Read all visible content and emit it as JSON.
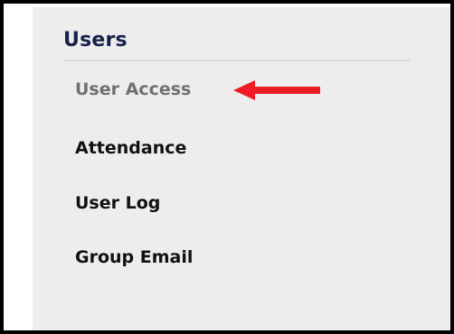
{
  "section": {
    "title": "Users"
  },
  "nav": {
    "items": [
      {
        "label": "User Access",
        "active": true
      },
      {
        "label": "Attendance",
        "active": false
      },
      {
        "label": "User Log",
        "active": false
      },
      {
        "label": "Group Email",
        "active": false
      },
      {
        "label": "",
        "active": false
      }
    ]
  },
  "annotation": {
    "arrow_color": "#ee1c24"
  }
}
